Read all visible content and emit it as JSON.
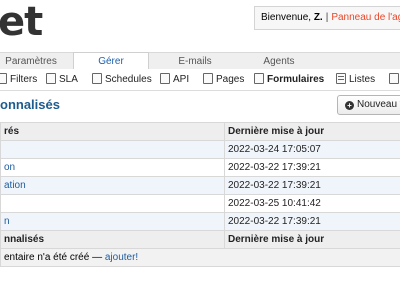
{
  "header": {
    "logo": "et",
    "welcome_prefix": "Bienvenue, ",
    "user": "Z.",
    "separator": "|",
    "panel_link": "Panneau de l'age"
  },
  "tabs": [
    {
      "label": "Paramètres"
    },
    {
      "label": "Gérer",
      "active": true
    },
    {
      "label": "E-mails"
    },
    {
      "label": "Agents"
    }
  ],
  "subnav": [
    {
      "label": "Filters",
      "icon": "filter-icon"
    },
    {
      "label": "SLA",
      "icon": "sla-icon"
    },
    {
      "label": "Schedules",
      "icon": "schedules-icon"
    },
    {
      "label": "API",
      "icon": "api-icon"
    },
    {
      "label": "Pages",
      "icon": "pages-icon"
    },
    {
      "label": "Formulaires",
      "icon": "forms-icon",
      "active": true
    },
    {
      "label": "Listes",
      "icon": "lists-icon"
    },
    {
      "label": "",
      "icon": "grid-icon"
    }
  ],
  "main": {
    "title": "onnalisés",
    "new_button": "Nouveau fo"
  },
  "table": {
    "headers": [
      "rés",
      "Dernière mise à jour"
    ],
    "rows": [
      {
        "name": "",
        "updated": "2022-03-24 17:05:07"
      },
      {
        "name": "on",
        "updated": "2022-03-22 17:39:21"
      },
      {
        "name": "ation",
        "updated": "2022-03-22 17:39:21"
      },
      {
        "name": "",
        "updated": "2022-03-25 10:41:42"
      },
      {
        "name": "n",
        "updated": "2022-03-22 17:39:21"
      }
    ],
    "footer_headers": [
      "nnalisés",
      "Dernière mise à jour"
    ],
    "footer_note_prefix": "entaire n'a été créé — ",
    "footer_note_link": "ajouter!"
  }
}
